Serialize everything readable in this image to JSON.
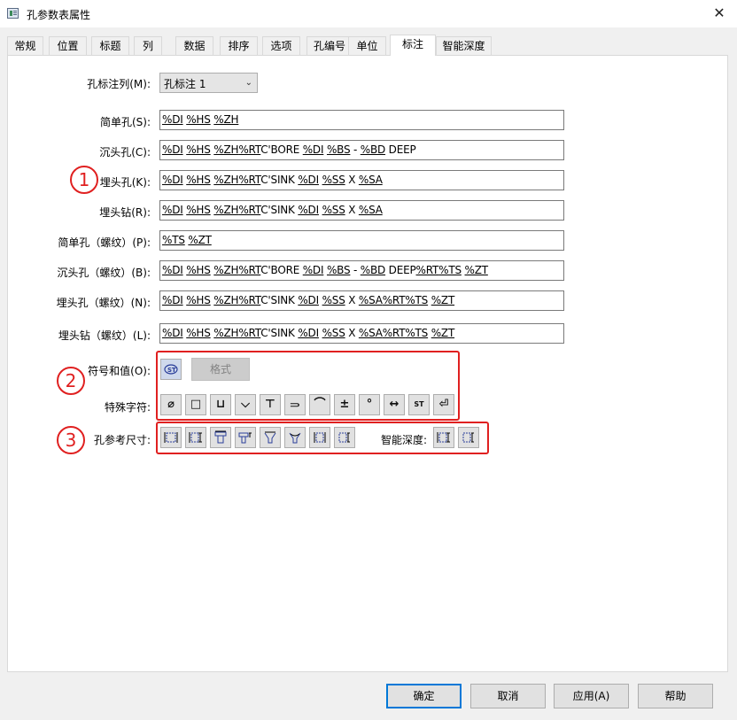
{
  "window": {
    "title": "孔参数表属性",
    "close_glyph": "✕"
  },
  "tabs": [
    {
      "label": "常规"
    },
    {
      "label": "位置"
    },
    {
      "label": "标题"
    },
    {
      "label": "列"
    },
    {
      "label": "数据"
    },
    {
      "label": "排序"
    },
    {
      "label": "选项"
    },
    {
      "label": "孔编号"
    },
    {
      "label": "单位"
    },
    {
      "label": "标注",
      "active": true
    },
    {
      "label": "智能深度"
    }
  ],
  "hole_tag_column": {
    "label": "孔标注列(M):",
    "selected": "孔标注 1"
  },
  "fields": [
    {
      "label": "简单孔(S):",
      "value": "%DI %HS %ZH"
    },
    {
      "label": "沉头孔(C):",
      "value": "%DI %HS %ZH%RTC'BORE %DI %BS - %BD DEEP"
    },
    {
      "label": "埋头孔(K):",
      "value": "%DI %HS %ZH%RTC'SINK %DI %SS X %SA"
    },
    {
      "label": "埋头钻(R):",
      "value": "%DI %HS %ZH%RTC'SINK %DI %SS X %SA"
    },
    {
      "label": "简单孔（螺纹）(P):",
      "value": "%TS %ZT"
    },
    {
      "label": "沉头孔（螺纹）(B):",
      "value": "%DI %HS %ZH%RTC'BORE %DI %BS - %BD DEEP%RT%TS %ZT"
    },
    {
      "label": "埋头孔（螺纹）(N):",
      "value": "%DI %HS %ZH%RTC'SINK %DI %SS X %SA%RT%TS %ZT"
    },
    {
      "label": "埋头钻（螺纹）(L):",
      "value": "%DI %HS %ZH%RTC'SINK %DI %SS X %SA%RT%TS %ZT"
    }
  ],
  "symbols": {
    "label": "符号和值(O):",
    "format_label": "格式",
    "special_label": "特殊字符:",
    "special_chars": [
      "⌀",
      "□",
      "⊔",
      "⌵",
      "⊤",
      "⥰",
      "⌒",
      "±",
      "°",
      "↔",
      "ST",
      "⏎"
    ]
  },
  "hole_ref": {
    "label": "孔参考尺寸:",
    "smart_depth_label": "智能深度:"
  },
  "callouts": [
    "1",
    "2",
    "3"
  ],
  "buttons": {
    "ok": "确定",
    "cancel": "取消",
    "apply": "应用(A)",
    "help": "帮助"
  },
  "colors": {
    "callout_red": "#e02020",
    "default_button_border": "#0078d7"
  }
}
